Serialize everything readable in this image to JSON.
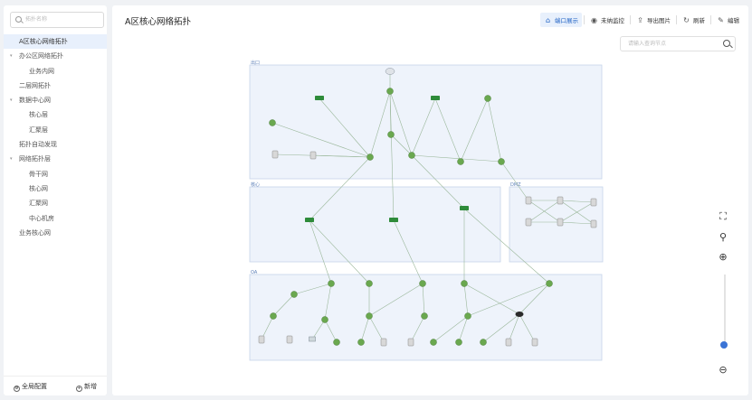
{
  "sidebar": {
    "search_placeholder": "拓扑名称",
    "items": [
      {
        "label": "A区核心网络拓扑",
        "level": 0,
        "expandable": false,
        "active": true
      },
      {
        "label": "办公区网络拓扑",
        "level": 0,
        "expandable": true,
        "active": false
      },
      {
        "label": "业务内网",
        "level": 1,
        "expandable": false,
        "active": false
      },
      {
        "label": "二层网拓扑",
        "level": 0,
        "expandable": false,
        "active": false
      },
      {
        "label": "数据中心网",
        "level": 0,
        "expandable": true,
        "active": false
      },
      {
        "label": "核心层",
        "level": 1,
        "expandable": false,
        "active": false
      },
      {
        "label": "汇聚层",
        "level": 1,
        "expandable": false,
        "active": false
      },
      {
        "label": "拓扑自动发现",
        "level": 0,
        "expandable": false,
        "active": false
      },
      {
        "label": "网络拓扑层",
        "level": 0,
        "expandable": true,
        "active": false
      },
      {
        "label": "骨干网",
        "level": 1,
        "expandable": false,
        "active": false
      },
      {
        "label": "核心网",
        "level": 1,
        "expandable": false,
        "active": false
      },
      {
        "label": "汇聚网",
        "level": 1,
        "expandable": false,
        "active": false
      },
      {
        "label": "中心机房",
        "level": 1,
        "expandable": false,
        "active": false
      },
      {
        "label": "业务核心网",
        "level": 0,
        "expandable": false,
        "active": false
      }
    ],
    "footer": {
      "global_config": "全局配置",
      "add_new": "新增"
    }
  },
  "header": {
    "title": "A区核心网络拓扑",
    "toolbar": [
      {
        "label": "端口展示",
        "icon": "port-icon",
        "active": true
      },
      {
        "label": "未纳监控",
        "icon": "monitor-icon",
        "active": false
      },
      {
        "label": "导出图片",
        "icon": "export-icon",
        "active": false
      },
      {
        "label": "刷新",
        "icon": "refresh-icon",
        "active": false
      },
      {
        "label": "编辑",
        "icon": "edit-icon",
        "active": false
      }
    ]
  },
  "canvas": {
    "search_placeholder": "请输入查询节点",
    "groups": [
      "出口",
      "核心",
      "DMZ",
      "OA"
    ]
  },
  "controls": {
    "zoom_level": 0.95
  },
  "colors": {
    "accent": "#1f62c4",
    "group_fill": "#eef3fb",
    "group_border": "#c6d4ea",
    "link": "#9ab79a",
    "switch": "#2e8b3a",
    "router": "#6aa84f"
  }
}
